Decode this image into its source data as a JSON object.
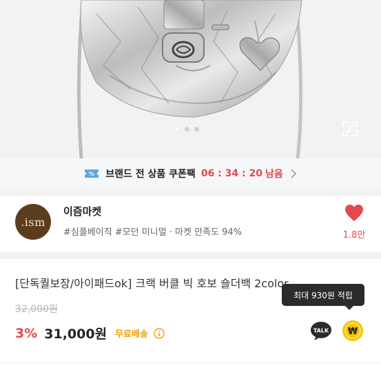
{
  "gallery": {
    "slide_count": 3,
    "active_slide": 1,
    "image_alt": ""
  },
  "promo": {
    "label": "브랜드 전 상품 쿠폰팩",
    "timer": "06 : 34 : 20",
    "suffix": "남음"
  },
  "shop": {
    "logo_text": ".ism",
    "name": "이즘마켓",
    "tags": "#심플베이직 #모던 미니멀 · 마켓 만족도 94%",
    "like_count": "1.8만"
  },
  "product": {
    "title": "[단독퀄보장/아이패드ok] 크랙 버클 빅 호보 숄더백 2color",
    "original_price": "32,000원",
    "discount": "3%",
    "price": "31,000원",
    "shipping": "무료배송"
  },
  "tooltip": {
    "text": "최대 930원 적립"
  },
  "buttons": {
    "talk_label": "TALK",
    "point_label": "₩"
  },
  "colors": {
    "accent_red": "#e5484d",
    "shipping_yellow": "#f0a000",
    "talk_yellow": "#fee500",
    "point_yellow": "#f7c600",
    "logo_brown": "#5b3d1e"
  }
}
